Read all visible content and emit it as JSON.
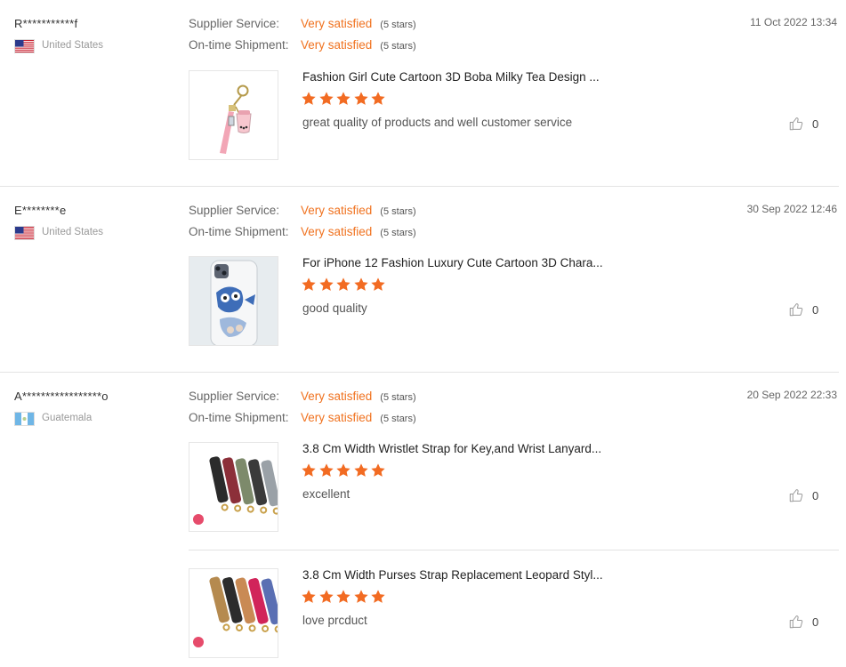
{
  "rating_labels": {
    "supplier": "Supplier Service:",
    "shipment": "On-time Shipment:"
  },
  "colors": {
    "accent": "#f0721f",
    "star": "#f26b22"
  },
  "reviews": [
    {
      "user": "R***********f",
      "country": "United States",
      "flag": "us-flag-icon",
      "date": "11 Oct 2022 13:34",
      "supplier_value": "Very satisfied",
      "supplier_stars": "(5 stars)",
      "shipment_value": "Very satisfied",
      "shipment_stars": "(5 stars)",
      "products": [
        {
          "title": "Fashion Girl Cute Cartoon 3D Boba Milky Tea Design ...",
          "rating": 5,
          "comment": "great quality of products and well customer service",
          "helpful_count": "0",
          "image": "boba-keychain-image"
        }
      ]
    },
    {
      "user": "E********e",
      "country": "United States",
      "flag": "us-flag-icon",
      "date": "30 Sep 2022 12:46",
      "supplier_value": "Very satisfied",
      "supplier_stars": "(5 stars)",
      "shipment_value": "Very satisfied",
      "shipment_stars": "(5 stars)",
      "products": [
        {
          "title": "For iPhone 12 Fashion Luxury Cute Cartoon 3D Chara...",
          "rating": 5,
          "comment": "good quality",
          "helpful_count": "0",
          "image": "phone-case-image"
        }
      ]
    },
    {
      "user": "A*****************o",
      "country": "Guatemala",
      "flag": "guatemala-flag-icon",
      "date": "20 Sep 2022 22:33",
      "supplier_value": "Very satisfied",
      "supplier_stars": "(5 stars)",
      "shipment_value": "Very satisfied",
      "shipment_stars": "(5 stars)",
      "products": [
        {
          "title": "3.8 Cm Width Wristlet Strap for Key,and Wrist Lanyard...",
          "rating": 5,
          "comment": "excellent",
          "helpful_count": "0",
          "image": "camo-straps-image"
        },
        {
          "title": "3.8 Cm Width Purses Strap Replacement Leopard Styl...",
          "rating": 5,
          "comment": "love prcduct",
          "helpful_count": "0",
          "image": "leopard-straps-image"
        }
      ]
    }
  ]
}
